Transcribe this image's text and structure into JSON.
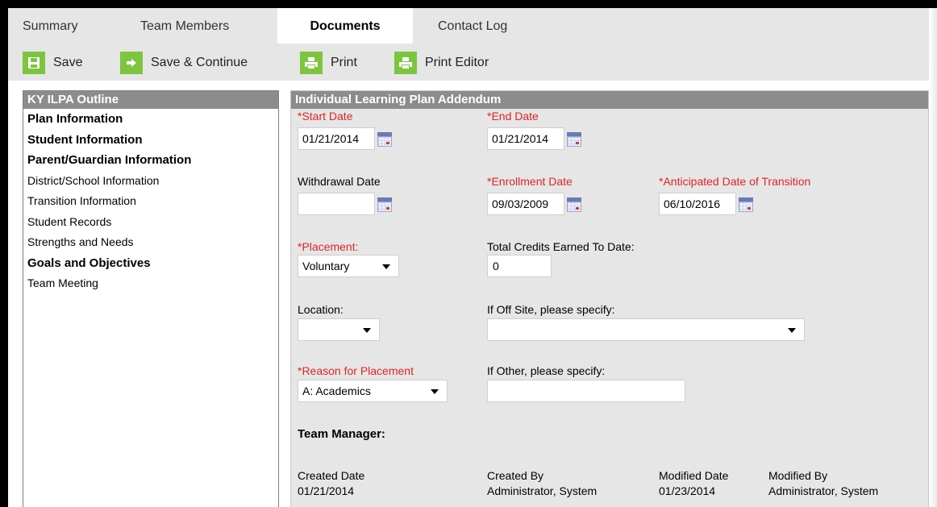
{
  "tabs": [
    {
      "label": "Summary",
      "active": false
    },
    {
      "label": "Team Members",
      "active": false
    },
    {
      "label": "Documents",
      "active": true
    },
    {
      "label": "Contact Log",
      "active": false
    }
  ],
  "toolbar": {
    "save": {
      "label": "Save",
      "icon": "save-icon"
    },
    "save_continue": {
      "label": "Save & Continue",
      "icon": "arrow-right-icon"
    },
    "print": {
      "label": "Print",
      "icon": "printer-icon"
    },
    "print_editor": {
      "label": "Print Editor",
      "icon": "printer-icon"
    }
  },
  "outline": {
    "title": "KY ILPA Outline",
    "items": [
      {
        "label": "Plan Information",
        "bold": true
      },
      {
        "label": "Student Information",
        "bold": true
      },
      {
        "label": "Parent/Guardian Information",
        "bold": true
      },
      {
        "label": "District/School Information",
        "bold": false
      },
      {
        "label": "Transition Information",
        "bold": false
      },
      {
        "label": "Student Records",
        "bold": false
      },
      {
        "label": "Strengths and Needs",
        "bold": false
      },
      {
        "label": "Goals and Objectives",
        "bold": true
      },
      {
        "label": "Team Meeting",
        "bold": false
      }
    ]
  },
  "form": {
    "title": "Individual Learning Plan Addendum",
    "start_date": {
      "label": "*Start Date",
      "value": "01/21/2014"
    },
    "end_date": {
      "label": "*End Date",
      "value": "01/21/2014"
    },
    "withdrawal_date": {
      "label": "Withdrawal Date",
      "value": ""
    },
    "enrollment_date": {
      "label": "*Enrollment Date",
      "value": "09/03/2009"
    },
    "transition_date": {
      "label": "*Anticipated Date of Transition",
      "value": "06/10/2016"
    },
    "placement": {
      "label": "*Placement:",
      "value": "Voluntary"
    },
    "total_credits": {
      "label": "Total Credits Earned To Date:",
      "value": "0"
    },
    "location": {
      "label": "Location:",
      "value": ""
    },
    "off_site": {
      "label": "If Off Site, please specify:",
      "value": ""
    },
    "reason": {
      "label": "*Reason for Placement",
      "value": "A: Academics"
    },
    "other": {
      "label": "If Other, please specify:",
      "value": ""
    },
    "team_manager": {
      "label": "Team Manager:"
    },
    "created_date": {
      "label": "Created Date",
      "value": "01/21/2014"
    },
    "created_by": {
      "label": "Created By",
      "value": "Administrator, System"
    },
    "modified_date": {
      "label": "Modified Date",
      "value": "01/23/2014"
    },
    "modified_by": {
      "label": "Modified By",
      "value": "Administrator, System"
    }
  },
  "colors": {
    "accent_green": "#7dc43f",
    "required_red": "#e02424",
    "panel_header": "#8c8c8c",
    "panel_bg": "#e6e6e6"
  }
}
